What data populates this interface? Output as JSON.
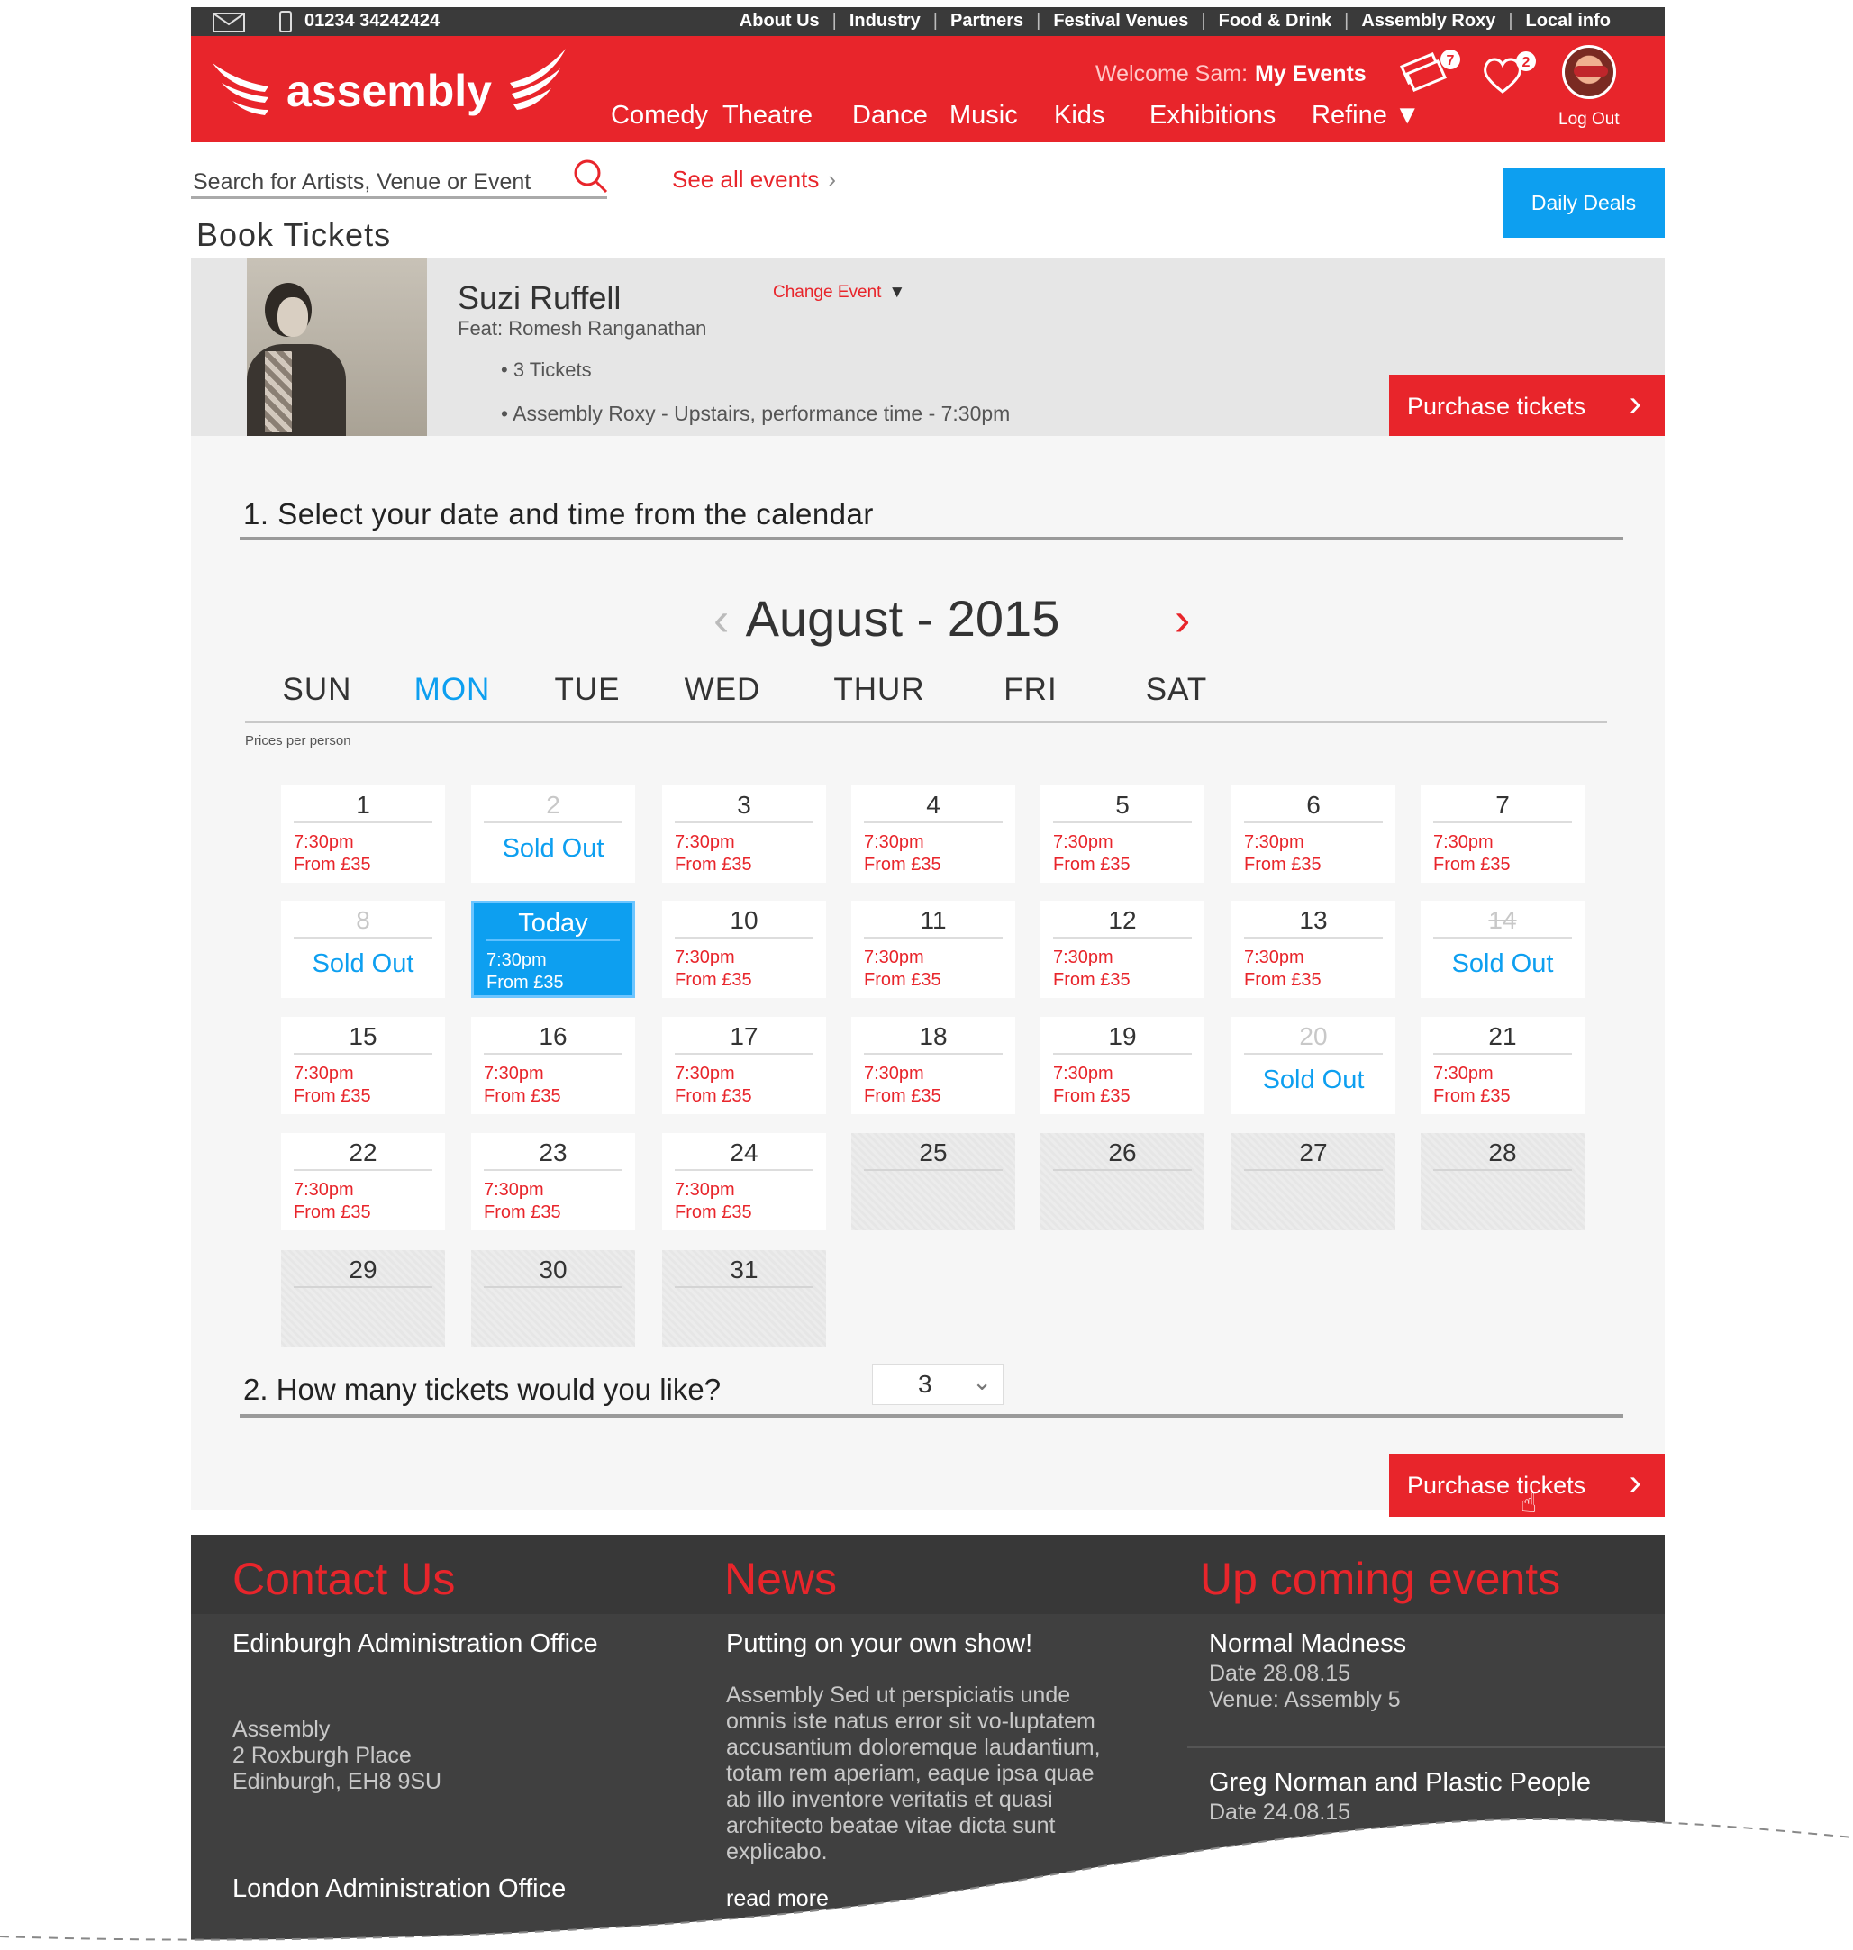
{
  "topbar": {
    "phone": "01234 34242424",
    "links": [
      "About Us",
      "Industry",
      "Partners",
      "Festival Venues",
      "Food & Drink",
      "Assembly Roxy",
      "Local info"
    ]
  },
  "header": {
    "logo": "assembly",
    "welcome": "Welcome Sam:",
    "my_events": "My Events",
    "ticket_badge": "7",
    "heart_badge": "2",
    "logout": "Log Out",
    "nav": [
      "Comedy",
      "Theatre",
      "Dance",
      "Music",
      "Kids",
      "Exhibitions",
      "Refine ▼"
    ]
  },
  "search": {
    "placeholder": "Search for Artists, Venue or Event",
    "see_all": "See all events"
  },
  "daily_deals": "Daily Deals",
  "page_title": "Book Tickets",
  "event": {
    "name": "Suzi Ruffell",
    "featuring": "Feat: Romesh Ranganathan",
    "change": "Change Event",
    "tickets": "• 3 Tickets",
    "venue": "• Assembly Roxy - Upstairs, performance time - 7:30pm",
    "purchase": "Purchase tickets"
  },
  "calendar": {
    "step": "1.  Select your date and time from the calendar",
    "month": "August - 2015",
    "weekdays": [
      "SUN",
      "MON",
      "TUE",
      "WED",
      "THUR",
      "FRI",
      "SAT"
    ],
    "prices_note": "Prices per person",
    "days": [
      {
        "label": "1",
        "status": "available"
      },
      {
        "label": "2",
        "status": "sold"
      },
      {
        "label": "3",
        "status": "available"
      },
      {
        "label": "4",
        "status": "available"
      },
      {
        "label": "5",
        "status": "available"
      },
      {
        "label": "6",
        "status": "available"
      },
      {
        "label": "7",
        "status": "available"
      },
      {
        "label": "8",
        "status": "sold"
      },
      {
        "label": "Today",
        "status": "today"
      },
      {
        "label": "10",
        "status": "available"
      },
      {
        "label": "11",
        "status": "available"
      },
      {
        "label": "12",
        "status": "available"
      },
      {
        "label": "13",
        "status": "available"
      },
      {
        "label": "14",
        "status": "sold-strike"
      },
      {
        "label": "15",
        "status": "available"
      },
      {
        "label": "16",
        "status": "available"
      },
      {
        "label": "17",
        "status": "available"
      },
      {
        "label": "18",
        "status": "available"
      },
      {
        "label": "19",
        "status": "available"
      },
      {
        "label": "20",
        "status": "sold"
      },
      {
        "label": "21",
        "status": "available"
      },
      {
        "label": "22",
        "status": "available"
      },
      {
        "label": "23",
        "status": "available"
      },
      {
        "label": "24",
        "status": "available"
      },
      {
        "label": "25",
        "status": "empty"
      },
      {
        "label": "26",
        "status": "empty"
      },
      {
        "label": "27",
        "status": "empty"
      },
      {
        "label": "28",
        "status": "empty"
      },
      {
        "label": "29",
        "status": "empty"
      },
      {
        "label": "30",
        "status": "empty"
      },
      {
        "label": "31",
        "status": "empty"
      }
    ],
    "time": "7:30pm",
    "price": "From £35",
    "sold_out": "Sold Out"
  },
  "tickets": {
    "step": "2.  How many tickets would you like?",
    "quantity": "3",
    "purchase": "Purchase tickets"
  },
  "footer": {
    "contact": {
      "heading": "Contact Us",
      "edinburgh_title": "Edinburgh Administration Office",
      "edinburgh_address": [
        "Assembly",
        "2 Roxburgh Place",
        "Edinburgh, EH8 9SU"
      ],
      "london_title": "London Administration Office"
    },
    "news": {
      "heading": "News",
      "title": "Putting on your own show!",
      "body": "Assembly Sed ut perspiciatis unde omnis iste natus error sit vo-luptatem accusantium doloremque laudantium, totam rem aperiam, eaque ipsa quae ab illo inventore veritatis et quasi architecto beatae vitae dicta sunt explicabo.",
      "read_more": "read more"
    },
    "upcoming": {
      "heading": "Up coming events",
      "events": [
        {
          "name": "Normal Madness",
          "date": "Date 28.08.15",
          "venue": "Venue: Assembly 5"
        },
        {
          "name": "Greg Norman and Plastic People",
          "date": "Date 24.08.15"
        }
      ]
    }
  },
  "colors": {
    "brand_red": "#e8252b",
    "accent_blue": "#0d9ff0",
    "footer_dark": "#404040"
  }
}
